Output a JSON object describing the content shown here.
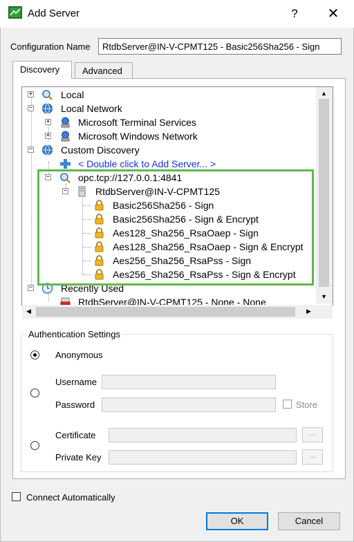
{
  "window": {
    "title": "Add Server",
    "help_label": "?",
    "close_label": "✕"
  },
  "config": {
    "label": "Configuration Name",
    "value": "RtdbServer@IN-V-CPMT125 - Basic256Sha256 - Sign"
  },
  "tabs": [
    {
      "label": "Discovery",
      "selected": true
    },
    {
      "label": "Advanced",
      "selected": false
    }
  ],
  "tree": {
    "local": "Local",
    "local_network": "Local Network",
    "terminal_services": "Microsoft Terminal Services",
    "windows_network": "Microsoft Windows Network",
    "custom_discovery": "Custom Discovery",
    "add_server_link": "< Double click to Add Server... >",
    "endpoint": "opc.tcp://127.0.0.1:4841",
    "server": "RtdbServer@IN-V-CPMT125",
    "policies": [
      "Basic256Sha256 - Sign",
      "Basic256Sha256 - Sign & Encrypt",
      "Aes128_Sha256_RsaOaep - Sign",
      "Aes128_Sha256_RsaOaep - Sign & Encrypt",
      "Aes256_Sha256_RsaPss - Sign",
      "Aes256_Sha256_RsaPss - Sign & Encrypt"
    ],
    "recently_used": "Recently Used",
    "recent_server": "RtdbServer@IN-V-CPMT125 - None - None",
    "expand_symbol": "+",
    "collapse_symbol": "−"
  },
  "auth": {
    "legend": "Authentication Settings",
    "anonymous": "Anonymous",
    "username": "Username",
    "password": "Password",
    "store": "Store",
    "certificate": "Certificate",
    "private_key": "Private Key",
    "browse_label": "...",
    "username_value": "",
    "password_value": "",
    "certificate_value": "",
    "private_key_value": "",
    "store_checked": false,
    "selected_mode": "anonymous"
  },
  "footer": {
    "connect_auto": "Connect Automatically",
    "connect_auto_checked": false,
    "ok": "OK",
    "cancel": "Cancel"
  },
  "colors": {
    "highlight_border": "#5db94c",
    "link": "#1a31d8",
    "default_button_border": "#0078d7"
  },
  "icons": {
    "app": "app-icon",
    "search": "search-icon",
    "network": "network-globe-icon",
    "monitor": "monitor-icon",
    "add": "plus-icon",
    "lock": "lock-icon",
    "server": "server-icon",
    "recent": "clock-icon",
    "recent_server": "red-server-icon"
  }
}
